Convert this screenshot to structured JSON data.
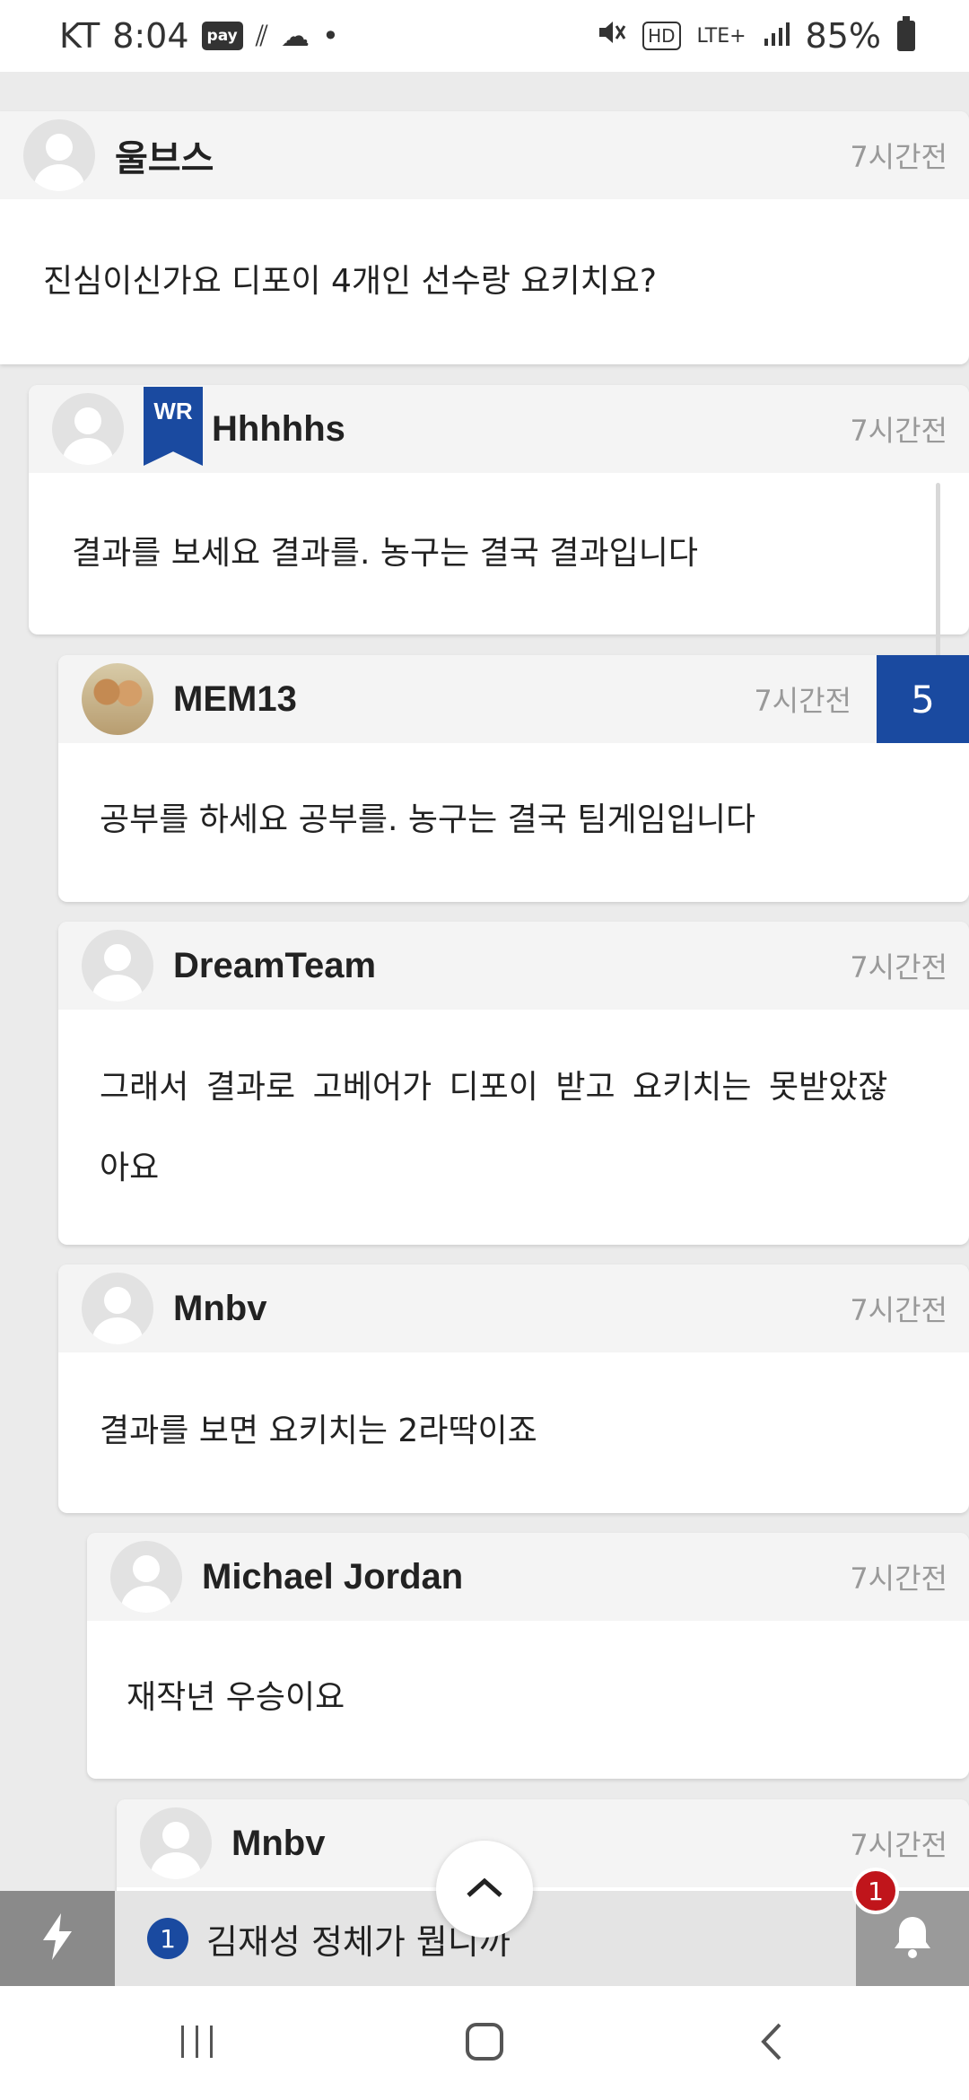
{
  "status_bar": {
    "carrier": "KT",
    "time": "8:04",
    "pay_label": "pay",
    "network": "LTE+",
    "hd_label": "HD",
    "battery": "85%"
  },
  "comments": [
    {
      "user": "울브스",
      "time": "7시간전",
      "text": "진심이신가요 디포이 4개인 선수랑 요키치요?"
    },
    {
      "user": "Hhhhhs",
      "badge": "WR",
      "time": "7시간전",
      "text": "결과를 보세요 결과를. 농구는 결국 결과입니다"
    },
    {
      "user": "MEM13",
      "time": "7시간전",
      "text": "공부를 하세요 공부를. 농구는 결국 팀게임입니다"
    },
    {
      "user": "DreamTeam",
      "time": "7시간전",
      "text_line1": "그래서 결과로 고베어가 디포이 받고 요키치는 못받았잖",
      "text_line2": "아요"
    },
    {
      "user": "Mnbv",
      "time": "7시간전",
      "text": "결과를 보면 요키치는 2라딱이죠"
    },
    {
      "user": "Michael Jordan",
      "time": "7시간전",
      "text": "재작년 우승이요"
    },
    {
      "user": "Mnbv",
      "time": "7시간전"
    }
  ],
  "page_badge": "5",
  "ticker": {
    "rank": "1",
    "text": "김재성 정체가 뭡니까"
  },
  "notification_count": "1",
  "icons": [
    "mute-icon",
    "signal-icon",
    "battery-icon",
    "lightning-icon",
    "bell-icon",
    "chevron-up-icon",
    "recents-icon",
    "home-icon",
    "back-icon"
  ]
}
